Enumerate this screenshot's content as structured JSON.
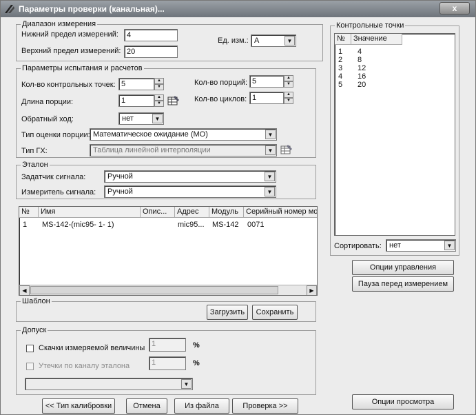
{
  "window": {
    "title": "Параметры проверки (канальная)...",
    "close_label": "x"
  },
  "range": {
    "legend": "Диапазон измерения",
    "lower_label": "Нижний предел измерений:",
    "lower_value": "4",
    "upper_label": "Верхний предел измерений:",
    "upper_value": "20",
    "unit_label": "Ед. изм.:",
    "unit_value": "A"
  },
  "params": {
    "legend": "Параметры испытания и расчетов",
    "points_label": "Кол-во контрольных точек:",
    "points_value": "5",
    "portion_len_label": "Длина порции:",
    "portion_len_value": "1",
    "portions_label": "Кол-во порций:",
    "portions_value": "5",
    "cycles_label": "Кол-во циклов:",
    "cycles_value": "1",
    "reverse_label": "Обратный ход:",
    "reverse_value": "нет",
    "estimate_label": "Тип оценки порции:",
    "estimate_value": "Математическое ожидание (МО)",
    "gx_label": "Тип ГХ:",
    "gx_value": "Таблица линейной интерполяции"
  },
  "etalon": {
    "legend": "Эталон",
    "setter_label": "Задатчик сигнала:",
    "setter_value": "Ручной",
    "meter_label": "Измеритель сигнала:",
    "meter_value": "Ручной"
  },
  "devices": {
    "columns": [
      "№",
      "Имя",
      "Опис...",
      "Адрес",
      "Модуль",
      "Серийный номер мо"
    ],
    "rows": [
      {
        "n": "1",
        "name": "MS-142-(mic95- 1- 1)",
        "desc": "",
        "addr": "mic95...",
        "module": "MS-142",
        "serial": "0071"
      }
    ]
  },
  "template": {
    "legend": "Шаблон",
    "load_label": "Загрузить",
    "save_label": "Сохранить"
  },
  "tolerance": {
    "legend": "Допуск",
    "jumps_label": "Скачки измеряемой величины",
    "jumps_value": "1",
    "leak_label": "Утечки по каналу эталона",
    "leak_value": "1",
    "pct": "%",
    "select_value": ""
  },
  "control_points": {
    "legend": "Контрольные точки",
    "columns": [
      "№",
      "Значение"
    ],
    "rows": [
      {
        "n": "1",
        "v": "4"
      },
      {
        "n": "2",
        "v": "8"
      },
      {
        "n": "3",
        "v": "12"
      },
      {
        "n": "4",
        "v": "16"
      },
      {
        "n": "5",
        "v": "20"
      }
    ],
    "sort_label": "Сортировать:",
    "sort_value": "нет"
  },
  "side_buttons": {
    "control_options": "Опции управления",
    "pause": "Пауза перед измерением",
    "view_options": "Опции просмотра"
  },
  "bottom_buttons": {
    "back": "<< Тип калибровки",
    "cancel": "Отмена",
    "from_file": "Из файла",
    "check": "Проверка >>"
  }
}
